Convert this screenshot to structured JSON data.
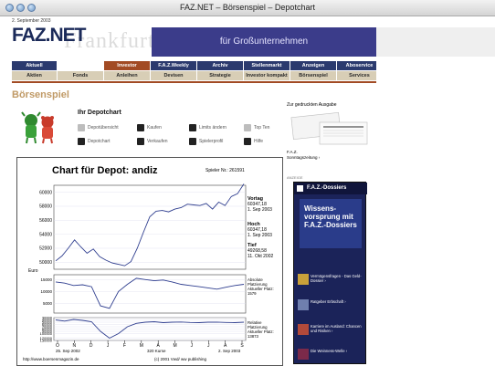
{
  "window": {
    "title": "FAZ.NET – Börsenspiel – Depotchart"
  },
  "masthead": {
    "date": "2. September 2003",
    "logo": "FAZ.NET",
    "gothic_text": "Frankfurter Allg",
    "ad_text": "für Großunternehmen"
  },
  "nav": {
    "row1": [
      {
        "label": "Aktuell"
      },
      {
        "label": ""
      },
      {
        "label": "Investor"
      },
      {
        "label": "F.A.Z.Weekly"
      },
      {
        "label": "Archiv"
      },
      {
        "label": "Stellenmarkt"
      },
      {
        "label": "Anzeigen"
      },
      {
        "label": "Aboservice"
      }
    ],
    "row2": [
      {
        "label": "Aktien"
      },
      {
        "label": "Fonds"
      },
      {
        "label": "Anleihen"
      },
      {
        "label": "Devisen"
      },
      {
        "label": "Strategie"
      },
      {
        "label": "Investor kompakt"
      },
      {
        "label": "Börsenspiel"
      },
      {
        "label": "Services"
      }
    ]
  },
  "section": {
    "title": "Börsenspiel"
  },
  "depot": {
    "title": "Ihr Depotchart",
    "actions": [
      {
        "label": "Depotübersicht",
        "icon": "doc-icon",
        "dark": false
      },
      {
        "label": "Kaufen",
        "icon": "buy-icon",
        "dark": true
      },
      {
        "label": "Limits ändern",
        "icon": "limit-icon",
        "dark": true
      },
      {
        "label": "Top Ten",
        "icon": "top-icon",
        "dark": false
      },
      {
        "label": "Depotchart",
        "icon": "chart-icon",
        "dark": true
      },
      {
        "label": "Verkaufen",
        "icon": "sell-icon",
        "dark": true
      },
      {
        "label": "Spielerprofil",
        "icon": "profile-icon",
        "dark": true
      },
      {
        "label": "Hilfe",
        "icon": "help-icon",
        "dark": true
      }
    ]
  },
  "chart_panel": {
    "title": "Chart für Depot:  andiz",
    "player": "Spieler Nr.: 261591",
    "stats": {
      "vortag_label": "Vortag",
      "vortag_value": "60347,18",
      "vortag_date": "1. Sep 2003",
      "hoch_label": "Hoch",
      "hoch_value": "60347,18",
      "hoch_date": "1. Sep 2003",
      "tief_label": "Tief",
      "tief_value": "49268,58",
      "tief_date": "11. Okt 2002"
    },
    "mid_label": "Absolute Platzierung",
    "mid_current_label": "Aktueller Platz:",
    "mid_current_value": "1579",
    "low_label": "Relative Platzierung",
    "low_current_label": "Aktueller Platz:",
    "low_current_value": "13873",
    "footer_left": "http://www.boersenmagazin.de",
    "footer_center": "(c) 2001 Vwd/ ww publishing",
    "x_start": "25. Sep 2002",
    "x_center": "320 Kurse",
    "x_end": "2. Sep 2003"
  },
  "chart_data": {
    "type": "line",
    "title": "Chart für Depot:  andiz",
    "xlabel": "",
    "ylabel": "Euro",
    "x_ticks": [
      "O",
      "N",
      "D",
      "J",
      "F",
      "M",
      "A",
      "M",
      "J",
      "J",
      "A",
      "S"
    ],
    "upper": {
      "y_ticks": [
        50000,
        52000,
        54000,
        56000,
        58000,
        60000
      ],
      "ylim": [
        49000,
        61000
      ],
      "values": [
        50200,
        50900,
        52000,
        53200,
        52200,
        51300,
        51900,
        50800,
        50300,
        49900,
        49700,
        49500,
        50100,
        52000,
        54300,
        56500,
        57300,
        57400,
        57200,
        57600,
        57800,
        58300,
        58200,
        58100,
        58400,
        57600,
        58600,
        58100,
        59400,
        59800,
        61200
      ]
    },
    "middle": {
      "y_ticks": [
        5000,
        10000,
        15000
      ],
      "ylim": [
        1000,
        17000
      ],
      "values": [
        14000,
        13500,
        12500,
        12800,
        12000,
        4000,
        3000,
        10000,
        13000,
        15500,
        15000,
        14500,
        14800,
        14000,
        13000,
        12500,
        12000,
        11500,
        11000,
        11800,
        12500,
        13000
      ]
    },
    "lower": {
      "y_ticks": [
        30000,
        40000,
        50000,
        60000,
        70000,
        80000,
        90000,
        100000,
        120000,
        130000
      ],
      "ylim": [
        130000,
        30000
      ],
      "values": [
        40000,
        45000,
        38000,
        42000,
        48000,
        90000,
        120000,
        100000,
        70000,
        55000,
        50000,
        48000,
        52000,
        50000,
        49000,
        51000,
        52000,
        50000,
        49500,
        51000,
        52000,
        50000
      ]
    }
  },
  "right_col": {
    "gedruckt": "Zur gedruckten Ausgabe",
    "faz_note_1": "F.A.Z.",
    "faz_note_2": "Sonntagszeitung ›",
    "anzeige": "ANZEIGE",
    "dossier_title": "F.A.Z.-Dossiers",
    "hero_line1": "Wissens-",
    "hero_line2": "vorsprung mit",
    "hero_line3": "F.A.Z.-Dossiers",
    "items": [
      {
        "label": "Vermögensfragen - Das Geld-Dossier ›"
      },
      {
        "label": "Ratgeber Erbschaft ›"
      },
      {
        "label": "Karriere im Ausland: Chancen und Risiken ›"
      },
      {
        "label": "Die Weinness-Welle ›"
      }
    ]
  },
  "colors": {
    "nav_dark": "#2b3a6e",
    "nav_active": "#a24b24",
    "nav_light": "#d8ceb6",
    "section_title": "#c09a66",
    "dossier": "#1b2359",
    "line": "#2f3e8f"
  }
}
